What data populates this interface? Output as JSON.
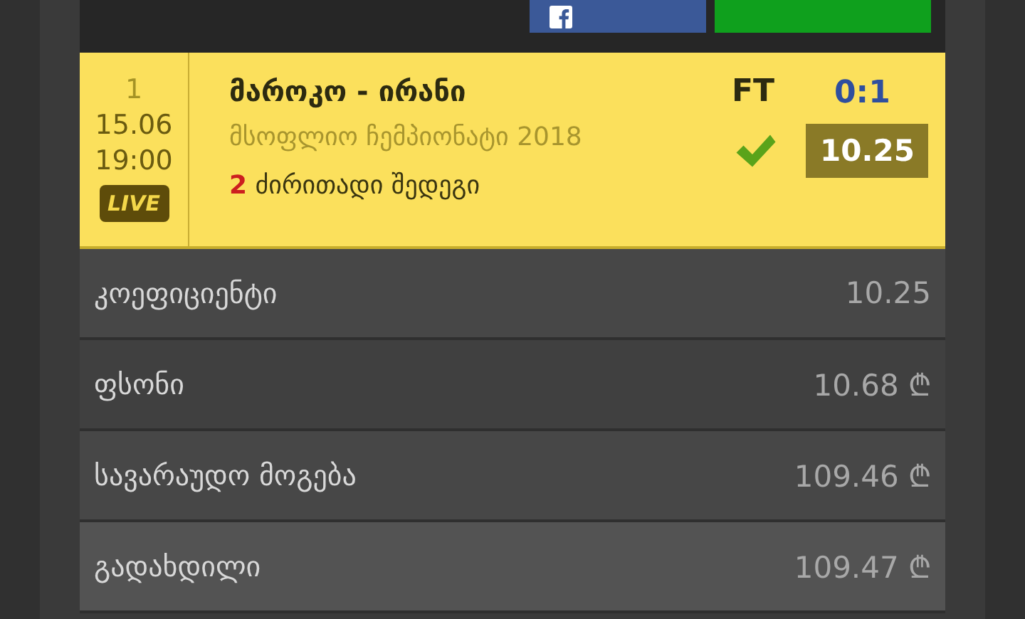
{
  "match": {
    "number": "1",
    "date": "15.06",
    "time": "19:00",
    "live_badge": "LIVE",
    "teams": "მაროკო - ირანი",
    "tournament": "მსოფლიო ჩემპიონატი 2018",
    "pick_number": "2",
    "pick_label": "ძირითადი შედეგი",
    "status": "FT",
    "score": "0:1",
    "won": true,
    "odds": "10.25"
  },
  "details": [
    {
      "label": "კოეფიციენტი",
      "value": "10.25",
      "highlighted": false
    },
    {
      "label": "ფსონი",
      "value": "10.68",
      "currency": "₾",
      "highlighted": false
    },
    {
      "label": "სავარაუდო მოგება",
      "value": "109.46",
      "currency": "₾",
      "highlighted": false
    },
    {
      "label": "გადახდილი",
      "value": "109.47",
      "currency": "₾",
      "highlighted": true
    }
  ]
}
